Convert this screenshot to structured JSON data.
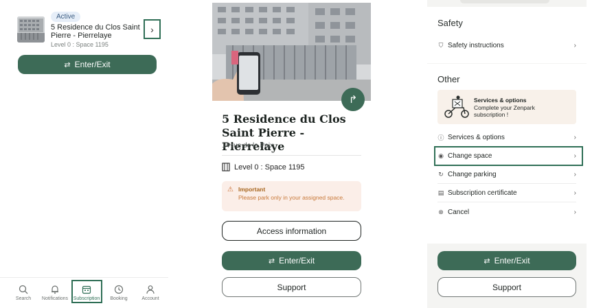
{
  "panel1": {
    "badge": "Active",
    "title": "5 Residence du Clos Saint Pierre - Pierrelaye",
    "level": "Level 0 : Space 1195",
    "enter_exit": "Enter/Exit",
    "tabs": [
      {
        "label": "Search",
        "icon": "search-icon"
      },
      {
        "label": "Notifications",
        "icon": "bell-icon"
      },
      {
        "label": "Subscription",
        "icon": "calendar-icon"
      },
      {
        "label": "Booking",
        "icon": "clock-icon"
      },
      {
        "label": "Account",
        "icon": "user-icon"
      }
    ],
    "active_tab": "Subscription"
  },
  "panel2": {
    "title": "5 Residence du Clos Saint Pierre - Pierrelaye",
    "address": "14 rue de la Paix",
    "level": "Level 0 : Space 1195",
    "notice_title": "Important",
    "notice_text": "Please park only in your assigned space.",
    "access_info": "Access information",
    "enter_exit": "Enter/Exit",
    "support": "Support"
  },
  "panel3": {
    "safety_heading": "Safety",
    "safety_instructions": "Safety instructions",
    "other_heading": "Other",
    "promo_title": "Services & options",
    "promo_text": "Complete your Zenpark subscription !",
    "services_options": "Services & options",
    "change_space": "Change space",
    "change_parking": "Change parking",
    "subscription_certificate": "Subscription certificate",
    "cancel": "Cancel",
    "enter_exit": "Enter/Exit",
    "support": "Support"
  },
  "colors": {
    "brand_green": "#3d6b57",
    "highlight_border": "#2e6e55",
    "notice_bg": "#fbeee8",
    "notice_text": "#c8793a"
  }
}
